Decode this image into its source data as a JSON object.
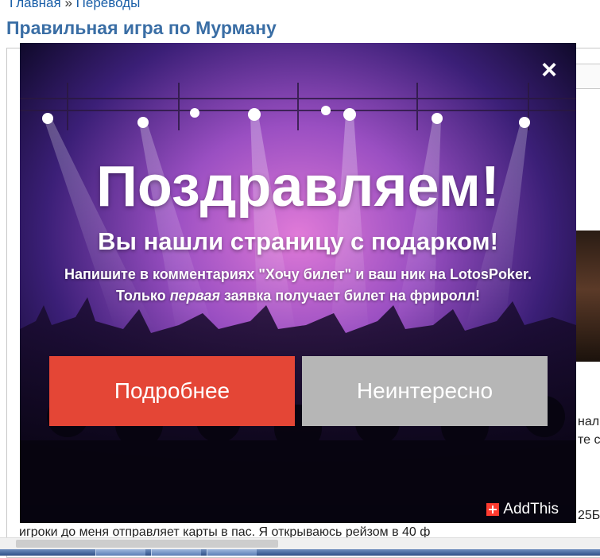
{
  "breadcrumb": {
    "home": "Главная",
    "separator": "»",
    "section": "Переводы"
  },
  "page": {
    "title": "Правильная игра по Мурману"
  },
  "background_text": {
    "right_fragment_1": "нал",
    "right_fragment_2": "те с",
    "right_fragment_3": "25Б",
    "bottom_line": "игроки до меня отправляет карты в пас. Я открываюсь рейзом в 40 ф"
  },
  "popup": {
    "close_label": "×",
    "heading": "Поздравляем!",
    "subheading": "Вы нашли страницу с подарком!",
    "line1": "Напишите в комментариях \"Хочу билет\" и ваш ник на LotosPoker.",
    "line2_prefix": "Только ",
    "line2_emphasis": "первая",
    "line2_suffix": " заявка получает билет на фриролл!",
    "primary_button": "Подробнее",
    "secondary_button": "Неинтересно",
    "branding": "AddThis"
  },
  "colors": {
    "link": "#1a5fa8",
    "title": "#3a6ea5",
    "primary_button": "#e44636",
    "secondary_button": "#b6b6b6",
    "addthis_brand": "#ff3b2f"
  }
}
